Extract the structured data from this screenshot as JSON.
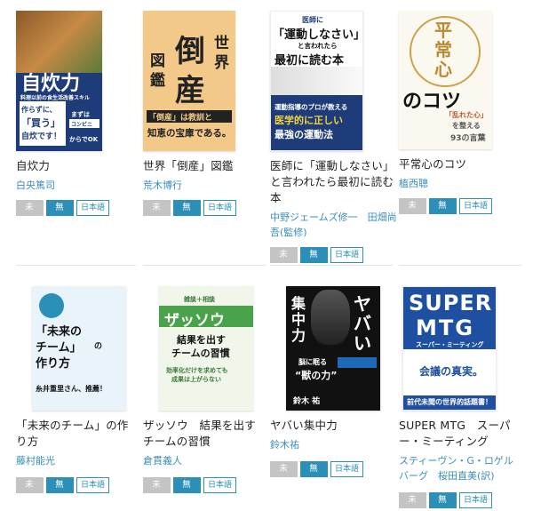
{
  "books": [
    {
      "title": "自炊力",
      "author": "白央篤司",
      "badges": {
        "unread": "未読",
        "free": "無料",
        "lang": "日本語"
      }
    },
    {
      "title": "世界「倒産」図鑑",
      "author": "荒木博行",
      "badges": {
        "unread": "未読",
        "free": "無料",
        "lang": "日本語"
      }
    },
    {
      "title": "医師に「運動しなさい」と言われたら最初に読む本",
      "author": "中野ジェームズ修一　田畑尚吾(監修)",
      "badges": {
        "unread": "未読",
        "free": "無料",
        "lang": "日本語"
      }
    },
    {
      "title": "平常心のコツ",
      "author": "植西聰",
      "badges": {
        "unread": "未読",
        "free": "無料",
        "lang": "日本語"
      }
    },
    {
      "title": "「未来のチーム」の作り方",
      "author": "藤村能光",
      "badges": {
        "unread": "未読",
        "free": "無料",
        "lang": "日本語"
      }
    },
    {
      "title": "ザッソウ　結果を出すチームの習慣",
      "author": "倉貫義人",
      "badges": {
        "unread": "未読",
        "free": "無料",
        "lang": "日本語"
      }
    },
    {
      "title": "ヤバい集中力",
      "author": "鈴木祐",
      "badges": {
        "unread": "未読",
        "free": "無料",
        "lang": "日本語"
      }
    },
    {
      "title": "SUPER MTG　スーパー・ミーティング",
      "author": "スティーヴン・G・ロゲルバーグ　桜田直美(訳)",
      "badges": {
        "unread": "未読",
        "free": "無料",
        "lang": "日本語"
      }
    }
  ],
  "covers": {
    "c1": {
      "main": "自炊力",
      "sub": "料理以前の食生活改善スキル",
      "a": "作らずに、",
      "b": "「買う」",
      "c": "自炊です！",
      "d": "まずは",
      "e": "コンビニ",
      "f": "からでOK"
    },
    "c2": {
      "a": "図",
      "b": "倒",
      "c": "世",
      "d": "界",
      "e": "鑑",
      "f": "産",
      "g": "「倒産」は教訓と",
      "h": "知恵の宝庫である。"
    },
    "c3": {
      "a": "医師に",
      "b": "「運動しなさい」",
      "c": "と言われたら",
      "d": "最初に読む本",
      "e": "運動指導のプロが教える",
      "f": "医学的に正しい",
      "g": "最強の運動法"
    },
    "c4": {
      "a": "平",
      "b": "常",
      "c": "心",
      "d": "のコツ",
      "e": "「乱れた心」",
      "f": "を整える",
      "g": "93の言葉"
    },
    "c5": {
      "a": "「未来の",
      "b": "チーム」",
      "c": "作り方",
      "d": "の",
      "e": "糸井重里さん、推薦！"
    },
    "c6": {
      "a": "ザッソウ",
      "b": "雑談＋相談",
      "c": "結果を出す",
      "d": "チームの習慣",
      "e": "効率化だけを求めても",
      "f": "成果は上がらない"
    },
    "c7": {
      "a": "ヤ",
      "b": "バ",
      "c": "い",
      "d": "集",
      "e": "中",
      "f": "力",
      "g": "脳に眠る",
      "h": "“獣の力”",
      "i": "鈴木 祐"
    },
    "c8": {
      "a": "SUPER",
      "b": "MTG",
      "c": "スーパー・ミーティング",
      "d": "会議の真実。",
      "e": "前代未聞の世界的話題書！"
    }
  }
}
